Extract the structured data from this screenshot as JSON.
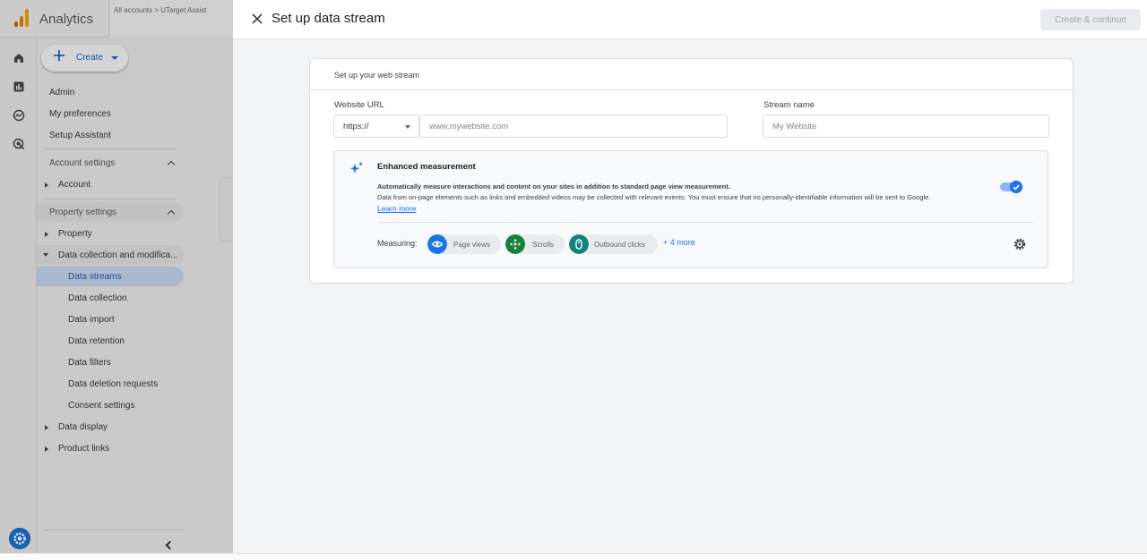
{
  "app": {
    "title": "Analytics",
    "breadcrumb": "All accounts > UTarget Assist"
  },
  "nav": {
    "create_label": "Create",
    "admin": "Admin",
    "my_preferences": "My preferences",
    "setup_assistant": "Setup Assistant",
    "account_settings": "Account settings",
    "account": "Account",
    "property_settings": "Property settings",
    "property": "Property",
    "data_collection_modification": "Data collection and modifica...",
    "data_streams": "Data streams",
    "data_collection": "Data collection",
    "data_import": "Data import",
    "data_retention": "Data retention",
    "data_filters": "Data filters",
    "data_deletion_requests": "Data deletion requests",
    "consent_settings": "Consent settings",
    "data_display": "Data display",
    "product_links": "Product links"
  },
  "panel": {
    "title": "Set up data stream",
    "create_continue_label": "Create & continue",
    "card_title": "Set up your web stream",
    "website_url_label": "Website URL",
    "protocol_value": "https://",
    "website_placeholder": "www.mywebsite.com",
    "stream_name_label": "Stream name",
    "stream_name_placeholder": "My Website"
  },
  "enhanced": {
    "title": "Enhanced measurement",
    "description_bold": "Automatically measure interactions and content on your sites in addition to standard page view measurement.",
    "description": "Data from on-page elements such as links and embedded videos may be collected with relevant events. You must ensure that no personally-identifiable information will be sent to Google.",
    "learn_more": "Learn more",
    "enabled": true,
    "measuring_label": "Measuring:",
    "chips": [
      {
        "label": "Page views",
        "icon": "eye-icon",
        "color": "#1a73e8"
      },
      {
        "label": "Scrolls",
        "icon": "scroll-arrows-icon",
        "color": "#188038"
      },
      {
        "label": "Outbound clicks",
        "icon": "mouse-icon",
        "color": "#12837c"
      }
    ],
    "more_label": "+ 4 more"
  },
  "colors": {
    "accent": "#1a73e8",
    "shell_dim": "#c9c9c9"
  }
}
